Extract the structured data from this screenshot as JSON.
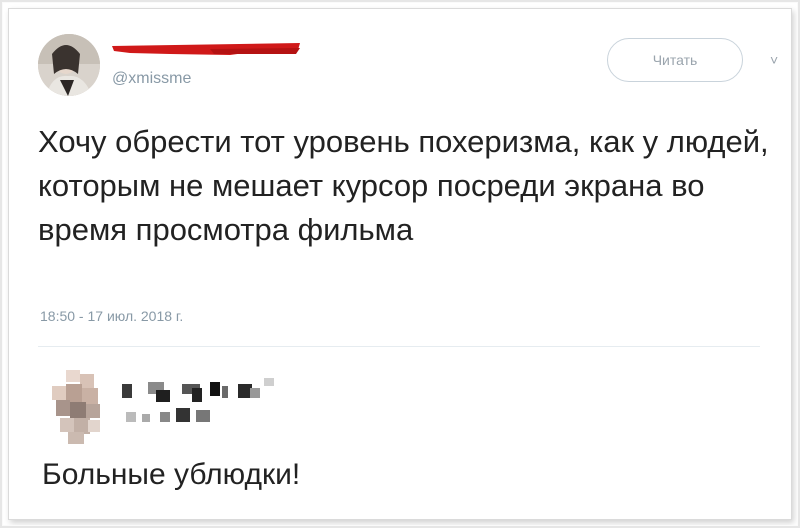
{
  "tweet": {
    "handle": "@xmissme",
    "follow_label": "Читать",
    "text": "Хочу обрести тот уровень похеризма, как у людей, которым не мешает курсор посреди экрана во время просмотра фильма",
    "timestamp": "18:50 - 17 июл. 2018 г."
  },
  "reply": {
    "text": "Больные ублюдки!"
  },
  "icons": {
    "more": "chevron-down-icon"
  }
}
